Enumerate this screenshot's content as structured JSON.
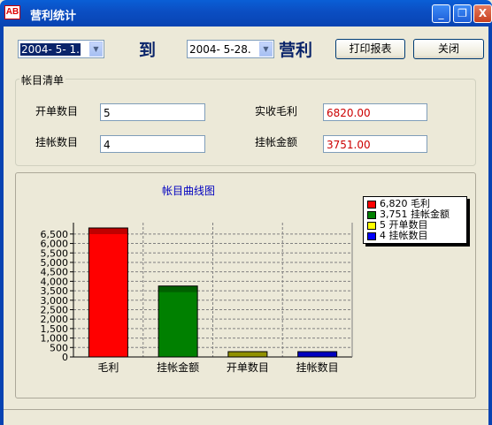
{
  "window": {
    "title": "营利统计",
    "minimize": "_",
    "restore": "❐",
    "close": "X",
    "app_icon": "profit-app-icon"
  },
  "toolbar": {
    "start_date": "2004- 5- 1.",
    "to_label": "到",
    "end_date": "2004- 5-28.",
    "profit_label": "营利",
    "print_button": "打印报表",
    "close_button": "关闭"
  },
  "ledger": {
    "title": "帐目清单",
    "open_count_label": "开单数目",
    "open_count_value": "5",
    "credit_count_label": "挂帐数目",
    "credit_count_value": "4",
    "gross_profit_label": "实收毛利",
    "gross_profit_value": "6820.00",
    "credit_amount_label": "挂帐金额",
    "credit_amount_value": "3751.00"
  },
  "colors": {
    "red": "#ff0000",
    "green": "#008000",
    "yellow": "#c0c000",
    "blue": "#0000ff"
  },
  "chart_data": {
    "type": "bar",
    "title": "帐目曲线图",
    "categories": [
      "毛利",
      "挂帐金额",
      "开单数目",
      "挂帐数目"
    ],
    "values": [
      6820,
      3751,
      5,
      4
    ],
    "colors": [
      "#ff0000",
      "#008000",
      "#c0c000",
      "#0000ff"
    ],
    "ylim": [
      0,
      6820
    ],
    "yticks": [
      0,
      500,
      1000,
      1500,
      2000,
      2500,
      3000,
      3500,
      4000,
      4500,
      5000,
      5500,
      6000,
      6500
    ],
    "ytick_labels": [
      "0",
      "500",
      "1,000",
      "1,500",
      "2,000",
      "2,500",
      "3,000",
      "3,500",
      "4,000",
      "4,500",
      "5,000",
      "5,500",
      "6,000",
      "6,500"
    ],
    "legend": [
      {
        "value": "6,820",
        "name": "毛利"
      },
      {
        "value": "3,751",
        "name": "挂帐金额"
      },
      {
        "value": "5",
        "name": "开单数目"
      },
      {
        "value": "4",
        "name": "挂帐数目"
      }
    ],
    "grid": true,
    "legend_position": "top-right"
  }
}
